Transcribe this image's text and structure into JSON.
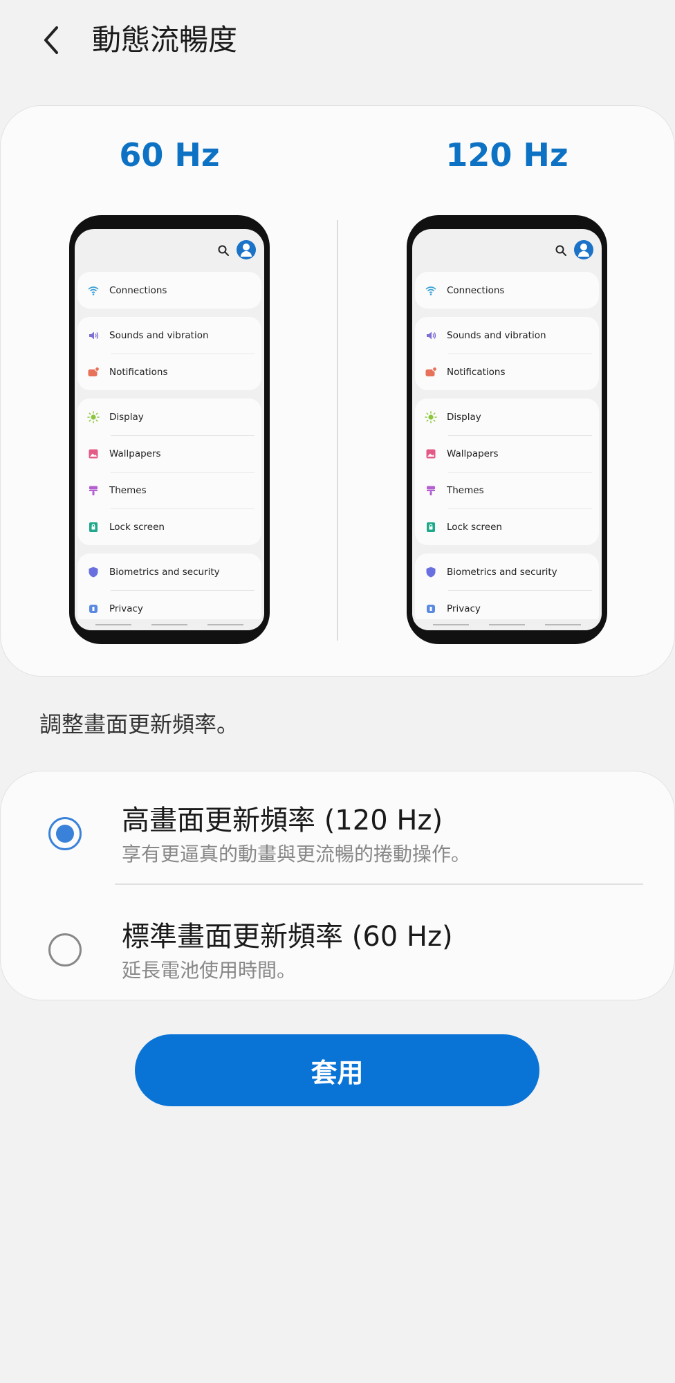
{
  "header": {
    "title": "動態流暢度",
    "back_icon": "chevron-left-icon"
  },
  "preview": {
    "left_label": "60 Hz",
    "right_label": "120 Hz",
    "accent_color": "#0e72c4",
    "settings_groups": [
      {
        "items": [
          {
            "label": "Connections",
            "icon": "wifi-icon",
            "color": "#3aa0d8"
          }
        ]
      },
      {
        "items": [
          {
            "label": "Sounds and vibration",
            "icon": "volume-icon",
            "color": "#7c6fd6"
          },
          {
            "label": "Notifications",
            "icon": "notification-icon",
            "color": "#e8715a"
          }
        ]
      },
      {
        "items": [
          {
            "label": "Display",
            "icon": "sun-icon",
            "color": "#8cc63f"
          },
          {
            "label": "Wallpapers",
            "icon": "image-icon",
            "color": "#e45a86"
          },
          {
            "label": "Themes",
            "icon": "brush-icon",
            "color": "#b35fd1"
          },
          {
            "label": "Lock screen",
            "icon": "lock-icon",
            "color": "#1fa88a"
          }
        ]
      },
      {
        "items": [
          {
            "label": "Biometrics and security",
            "icon": "shield-icon",
            "color": "#6a6fe0"
          },
          {
            "label": "Privacy",
            "icon": "privacy-icon",
            "color": "#5a8ae0"
          }
        ]
      }
    ]
  },
  "description": "調整畫面更新頻率。",
  "options": [
    {
      "title": "高畫面更新頻率 (120 Hz)",
      "subtitle": "享有更逼真的動畫與更流暢的捲動操作。",
      "selected": true
    },
    {
      "title": "標準畫面更新頻率 (60 Hz)",
      "subtitle": "延長電池使用時間。",
      "selected": false
    }
  ],
  "apply_button": {
    "label": "套用",
    "color": "#0a74d6"
  }
}
